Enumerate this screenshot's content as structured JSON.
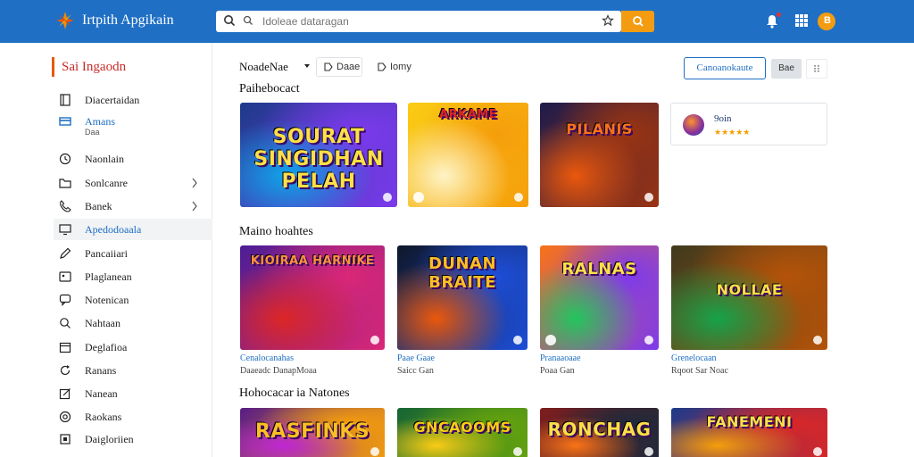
{
  "header": {
    "app_title": "Irtpith Apgikain",
    "search_placeholder": "Idoleae dataragan",
    "avatar_letter": "B"
  },
  "sidebar": {
    "heading": "Sai Ingaodn",
    "items": [
      {
        "label": "Diacertaidan",
        "icon": "book-icon"
      },
      {
        "label": "Amans",
        "sub": "Daa",
        "icon": "card-icon"
      },
      {
        "label": "Naonlain",
        "icon": "clock-icon"
      },
      {
        "label": "Sonlcanre",
        "icon": "folder-icon"
      },
      {
        "label": "Banek",
        "icon": "phone-icon"
      },
      {
        "label": "Apedodoaala",
        "icon": "monitor-icon"
      },
      {
        "label": "Pancaiiari",
        "icon": "pen-icon"
      },
      {
        "label": "Plaglanean",
        "icon": "image-icon"
      },
      {
        "label": "Notenican",
        "icon": "chat-icon"
      },
      {
        "label": "Nahtaan",
        "icon": "search-icon"
      },
      {
        "label": "Deglafioa",
        "icon": "calendar-icon"
      },
      {
        "label": "Ranans",
        "icon": "refresh-icon"
      },
      {
        "label": "Nanean",
        "icon": "edit-icon"
      },
      {
        "label": "Raokans",
        "icon": "target-icon"
      },
      {
        "label": "Daigloriien",
        "icon": "square-icon"
      }
    ]
  },
  "toolbar": {
    "sort_label": "NoadeNae",
    "chip_1": "Daae",
    "chip_2": "Iomy",
    "primary_button": "Canoanokaute",
    "grey_button": "Bae",
    "more_button": "⁝⁝"
  },
  "sections": {
    "s1": "Paihebocact",
    "s2": "Maino hoahtes",
    "s3": "Hohocacar ia Natones"
  },
  "row1": [
    {
      "art": "SOURAT SINGIDHAN PELAH",
      "colors": [
        "#1e3a8a",
        "#7c3aed",
        "#0ea5e9"
      ],
      "title_color": "#fde047"
    },
    {
      "art": "ARKAME",
      "colors": [
        "#facc15",
        "#f59e0b",
        "#fef3c7"
      ],
      "title_color": "#dc2626"
    },
    {
      "art": "PILANIS",
      "colors": [
        "#1e1b4b",
        "#9a3412",
        "#ea580c"
      ],
      "title_color": "#f97316"
    }
  ],
  "side_card": {
    "name": "9oin",
    "stars": "★★★★★"
  },
  "row2": [
    {
      "art": "KIOIRAA HARNIKE",
      "colors": [
        "#4c1d95",
        "#db2777",
        "#dc2626"
      ],
      "title_color": "#fb923c",
      "caption_title": "Cenalocanahas",
      "caption_sub": "Daaeadc DanapMoaa"
    },
    {
      "art": "DUNAN BRAITE",
      "colors": [
        "#0f172a",
        "#1d4ed8",
        "#ea580c"
      ],
      "title_color": "#fbbf24",
      "caption_title": "Paae Gaae",
      "caption_sub": "Saicc Gan"
    },
    {
      "art": "RALNAS",
      "colors": [
        "#f97316",
        "#7c3aed",
        "#22c55e"
      ],
      "title_color": "#fde047",
      "caption_title": "Pranaaoaae",
      "caption_sub": "Poaa Gan"
    },
    {
      "art": "NOLLAE",
      "colors": [
        "#3f3a1e",
        "#b45309",
        "#16a34a"
      ],
      "title_color": "#fde047",
      "caption_title": "Grenelocaan",
      "caption_sub": "Rqoot Sar Noac"
    }
  ],
  "row3": [
    {
      "art": "RASFINKS",
      "colors": [
        "#581c87",
        "#f59e0b",
        "#c026d3"
      ],
      "title_color": "#fbbf24"
    },
    {
      "art": "GNCAOOMS",
      "colors": [
        "#166534",
        "#65a30d",
        "#facc15"
      ],
      "title_color": "#facc15"
    },
    {
      "art": "RONCHAG",
      "colors": [
        "#7f1d1d",
        "#1e293b",
        "#f97316"
      ],
      "title_color": "#fde047"
    },
    {
      "art": "FANEMENI",
      "colors": [
        "#1e3a8a",
        "#dc2626",
        "#f59e0b"
      ],
      "title_color": "#fde047"
    }
  ]
}
